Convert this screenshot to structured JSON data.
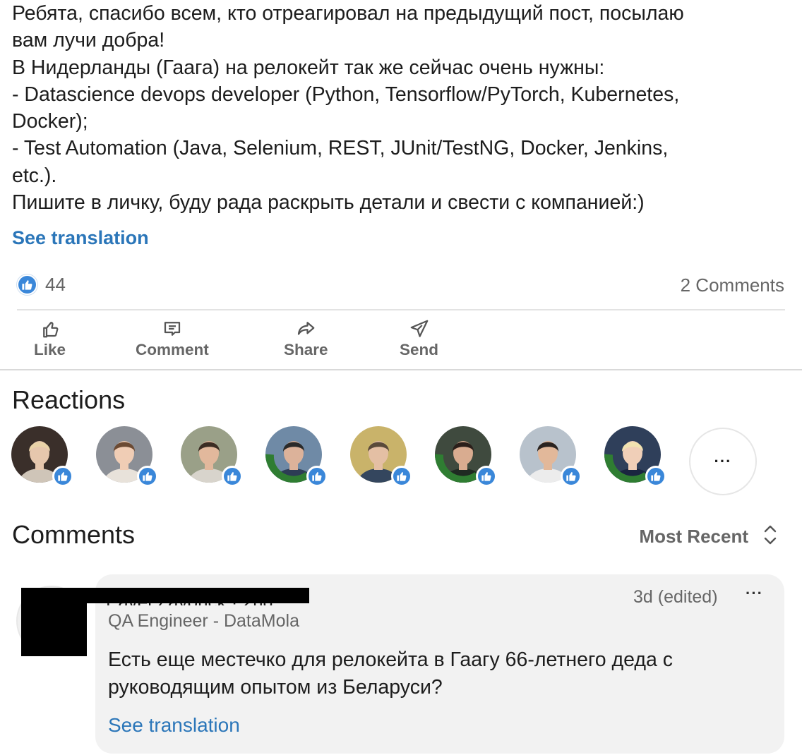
{
  "post": {
    "text_lines": [
      "Ребята, спасибо всем, кто отреагировал на предыдущий пост, посылаю",
      "вам лучи добра!",
      "В Нидерланды (Гаага) на релокейт так же сейчас очень нужны:",
      "- Datascience devops developer (Python, Tensorflow/PyTorch, Kubernetes,",
      "Docker);",
      "- Test Automation (Java, Selenium, REST, JUnit/TestNG, Docker, Jenkins,",
      "etc.).",
      "Пишите в личку, буду рада раскрыть детали и свести с компанией:)"
    ],
    "see_translation": "See translation",
    "reactions_count": "44",
    "comments_count": "2 Comments"
  },
  "actions": {
    "like": "Like",
    "comment": "Comment",
    "share": "Share",
    "send": "Send"
  },
  "reactions": {
    "heading": "Reactions",
    "more": "···",
    "avatars": [
      {
        "icon": "person-photo",
        "bg": "#3a2f2a",
        "face": "#e6c7ad",
        "hair": "#e9d3a8",
        "shirt": "#cfc5b8"
      },
      {
        "icon": "person-photo",
        "bg": "#8b8f96",
        "face": "#f0cdb5",
        "hair": "#6b4a33",
        "shirt": "#e8e2da"
      },
      {
        "icon": "person-photo",
        "bg": "#9aa088",
        "face": "#e2b89c",
        "hair": "#3b2c23",
        "shirt": "#d8d4cc"
      },
      {
        "icon": "opentowork-photo",
        "bg": "#6f8aa6",
        "face": "#dcb29a",
        "hair": "#2a2a2a",
        "shirt": "#2d3d55"
      },
      {
        "icon": "person-photo",
        "bg": "#c9b36a",
        "face": "#e4bfa4",
        "hair": "#5a4a3a",
        "shirt": "#34465e"
      },
      {
        "icon": "opentowork-photo",
        "bg": "#3f4a3e",
        "face": "#d9ac90",
        "hair": "#2b1f1a",
        "shirt": "#1f2a22"
      },
      {
        "icon": "person-photo",
        "bg": "#b8c2cc",
        "face": "#e2b89a",
        "hair": "#2a2320",
        "shirt": "#ececec"
      },
      {
        "icon": "opentowork-photo",
        "bg": "#2f3f5a",
        "face": "#f0cfb8",
        "hair": "#f1e2b0",
        "shirt": "#1a2540"
      }
    ]
  },
  "comments": {
    "heading": "Comments",
    "sort_label": "Most Recent",
    "items": [
      {
        "author_partial": "Pavel Zayonck · 2nd",
        "headline": "QA Engineer - DataMola",
        "time": "3d (edited)",
        "more": "···",
        "text_lines": [
          "Есть еще местечко для релокейта в Гаагу 66-летнего деда с",
          "руководящим опытом из Беларуси?"
        ],
        "see_translation": "See translation"
      }
    ]
  },
  "colors": {
    "link_blue": "#2b76b9",
    "like_blue": "#3a87d9",
    "opentowork_green": "#2f7d32"
  }
}
